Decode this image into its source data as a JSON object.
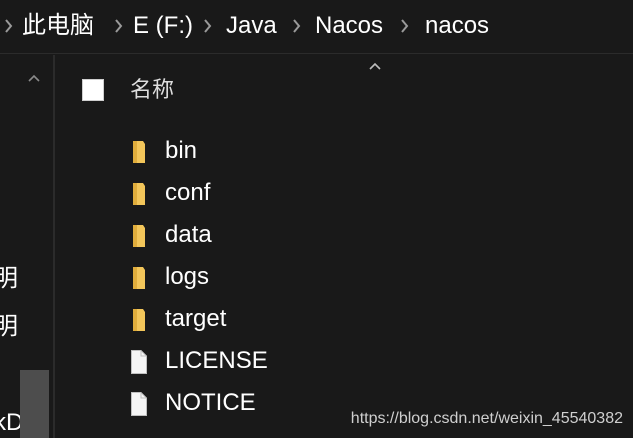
{
  "breadcrumb": {
    "items": [
      "此电脑",
      "E (F:)",
      "Java",
      "Nacos",
      "nacos"
    ]
  },
  "nav_pane": {
    "partial_labels": [
      "明",
      "明",
      "kD"
    ]
  },
  "file_list": {
    "header": {
      "name_label": "名称"
    },
    "items": [
      {
        "name": "bin",
        "type": "folder"
      },
      {
        "name": "conf",
        "type": "folder"
      },
      {
        "name": "data",
        "type": "folder"
      },
      {
        "name": "logs",
        "type": "folder"
      },
      {
        "name": "target",
        "type": "folder"
      },
      {
        "name": "LICENSE",
        "type": "file"
      },
      {
        "name": "NOTICE",
        "type": "file"
      }
    ]
  },
  "watermark": "https://blog.csdn.net/weixin_45540382",
  "colors": {
    "background": "#191919",
    "folder": "#f3c65a",
    "text": "#ffffff",
    "separator": "#9a9a9a"
  },
  "icons": {
    "breadcrumb_separator": "chevron-right-icon",
    "folder": "folder-icon",
    "file": "file-icon",
    "sort": "chevron-up-icon",
    "nav_scroll": "chevron-up-icon"
  }
}
